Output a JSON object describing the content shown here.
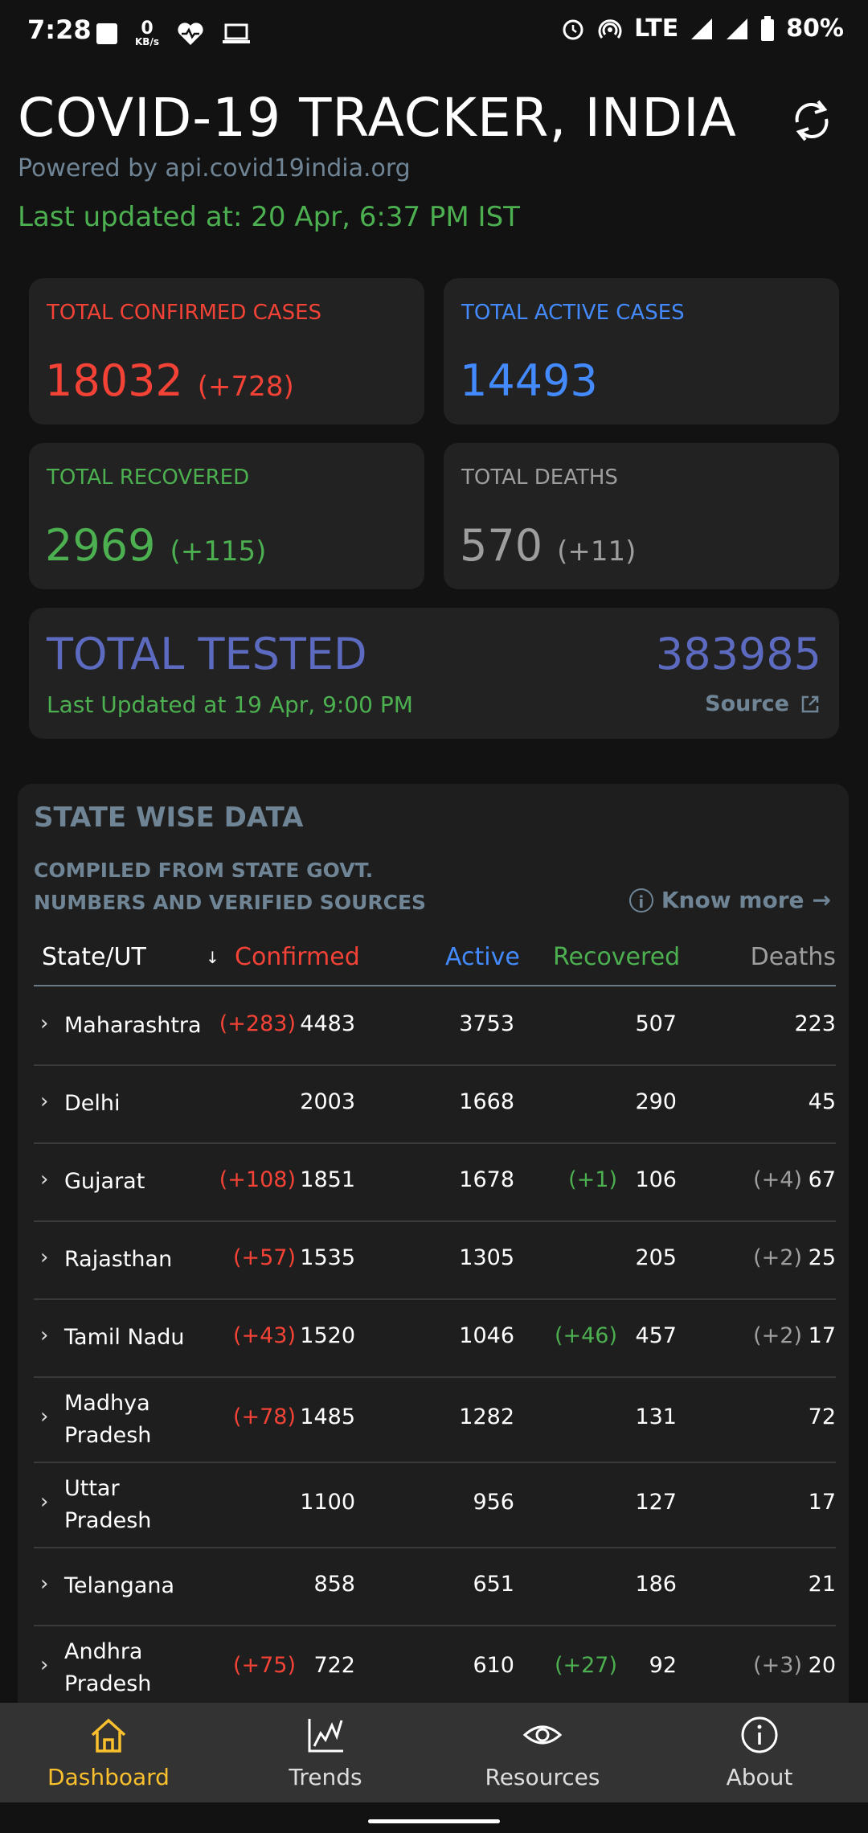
{
  "status": {
    "time": "7:28",
    "kbs_value": "0",
    "kbs_unit": "KB/s",
    "network": "LTE",
    "battery": "80%"
  },
  "header": {
    "title": "COVID-19 TRACKER, INDIA",
    "powered": "Powered by api.covid19india.org",
    "last_updated": "Last updated at: 20 Apr,  6:37 PM IST"
  },
  "cards": {
    "confirmed": {
      "label": "TOTAL CONFIRMED CASES",
      "value": "18032",
      "delta": "(+728)"
    },
    "active": {
      "label": "TOTAL ACTIVE CASES",
      "value": "14493"
    },
    "recovered": {
      "label": "TOTAL RECOVERED",
      "value": "2969",
      "delta": "(+115)"
    },
    "deaths": {
      "label": "TOTAL DEATHS",
      "value": "570",
      "delta": "(+11)"
    },
    "tested": {
      "label": "TOTAL TESTED",
      "value": "383985",
      "updated": "Last Updated at 19 Apr,  9:00 PM",
      "source": "Source"
    }
  },
  "statewise": {
    "title": "STATE WISE DATA",
    "subtitle_line1": "COMPILED FROM STATE GOVT.",
    "subtitle_line2": "NUMBERS AND VERIFIED SOURCES",
    "know_more": "Know more",
    "headers": {
      "state": "State/UT",
      "confirmed": "Confirmed",
      "active": "Active",
      "recovered": "Recovered",
      "deaths": "Deaths"
    },
    "rows": [
      {
        "name1": "Maharashtra",
        "name2": "",
        "c_delta": "(+283)",
        "confirmed": "4483",
        "active": "3753",
        "r_delta": "",
        "recovered": "507",
        "d_delta": "",
        "deaths": "223"
      },
      {
        "name1": "Delhi",
        "name2": "",
        "c_delta": "",
        "confirmed": "2003",
        "active": "1668",
        "r_delta": "",
        "recovered": "290",
        "d_delta": "",
        "deaths": "45"
      },
      {
        "name1": "Gujarat",
        "name2": "",
        "c_delta": "(+108)",
        "confirmed": "1851",
        "active": "1678",
        "r_delta": "(+1)",
        "recovered": "106",
        "d_delta": "(+4)",
        "deaths": "67"
      },
      {
        "name1": "Rajasthan",
        "name2": "",
        "c_delta": "(+57)",
        "confirmed": "1535",
        "active": "1305",
        "r_delta": "",
        "recovered": "205",
        "d_delta": "(+2)",
        "deaths": "25"
      },
      {
        "name1": "Tamil Nadu",
        "name2": "",
        "c_delta": "(+43)",
        "confirmed": "1520",
        "active": "1046",
        "r_delta": "(+46)",
        "recovered": "457",
        "d_delta": "(+2)",
        "deaths": "17"
      },
      {
        "name1": "Madhya",
        "name2": "Pradesh",
        "c_delta": "(+78)",
        "confirmed": "1485",
        "active": "1282",
        "r_delta": "",
        "recovered": "131",
        "d_delta": "",
        "deaths": "72"
      },
      {
        "name1": "Uttar",
        "name2": "Pradesh",
        "c_delta": "",
        "confirmed": "1100",
        "active": "956",
        "r_delta": "",
        "recovered": "127",
        "d_delta": "",
        "deaths": "17"
      },
      {
        "name1": "Telangana",
        "name2": "",
        "c_delta": "",
        "confirmed": "858",
        "active": "651",
        "r_delta": "",
        "recovered": "186",
        "d_delta": "",
        "deaths": "21"
      },
      {
        "name1": "Andhra",
        "name2": "Pradesh",
        "c_delta": "(+75)",
        "confirmed": "722",
        "active": "610",
        "r_delta": "(+27)",
        "recovered": "92",
        "d_delta": "(+3)",
        "deaths": "20"
      }
    ]
  },
  "nav": {
    "dashboard": "Dashboard",
    "trends": "Trends",
    "resources": "Resources",
    "about": "About"
  },
  "colors": {
    "confirmed": "#f44336",
    "active": "#448aff",
    "recovered": "#4caf50",
    "deaths": "#9e9e9e",
    "tested": "#5c6bc0",
    "nav_active": "#fbc02d",
    "muted": "#6f8596"
  }
}
